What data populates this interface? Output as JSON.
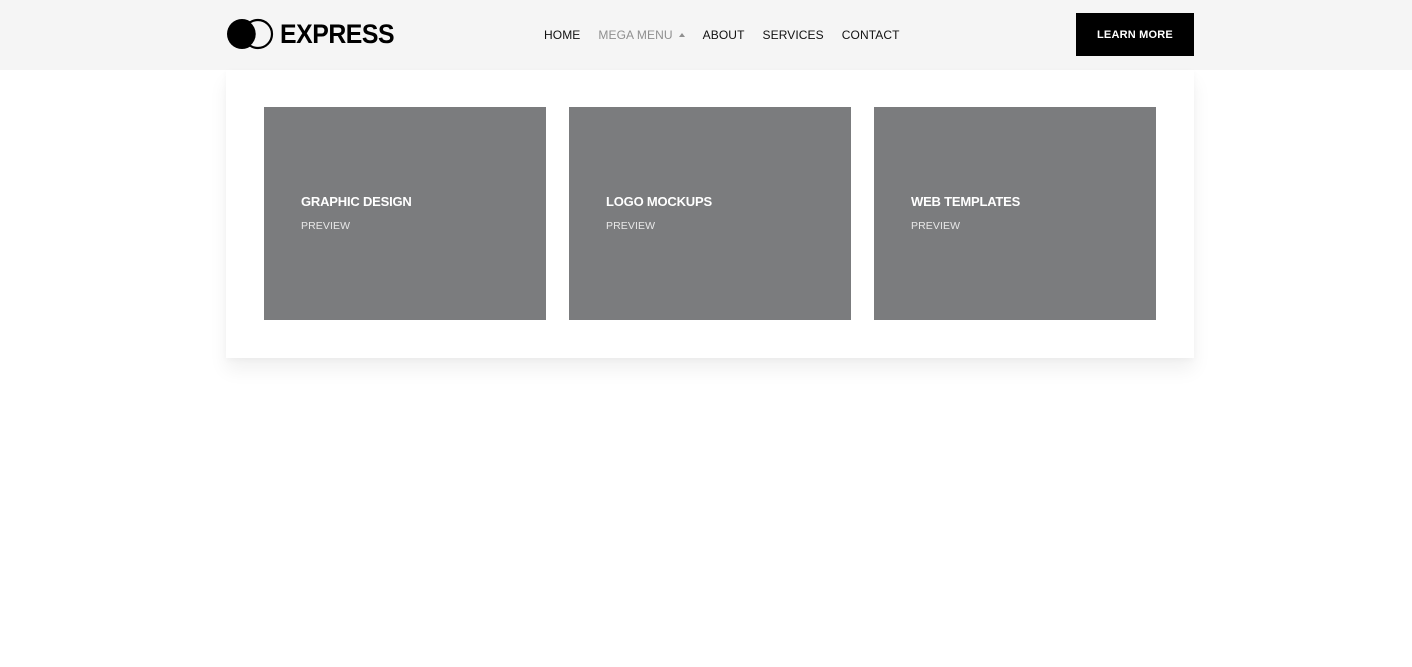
{
  "brand": {
    "name": "EXPRESS",
    "logo_icon": "overlapping-circles-icon"
  },
  "nav": {
    "items": [
      {
        "label": "HOME",
        "active": false
      },
      {
        "label": "MEGA MENU",
        "active": true,
        "icon": "caret-up-icon"
      },
      {
        "label": "ABOUT",
        "active": false
      },
      {
        "label": "SERVICES",
        "active": false
      },
      {
        "label": "CONTACT",
        "active": false
      }
    ]
  },
  "cta": {
    "label": "LEARN MORE"
  },
  "mega_menu": {
    "cards": [
      {
        "title": "GRAPHIC DESIGN",
        "subtitle": "PREVIEW"
      },
      {
        "title": "LOGO MOCKUPS",
        "subtitle": "PREVIEW"
      },
      {
        "title": "WEB TEMPLATES",
        "subtitle": "PREVIEW"
      }
    ]
  },
  "colors": {
    "header_bg": "#f5f5f5",
    "card_bg": "#7b7c7e",
    "cta_bg": "#000000",
    "active_nav": "#8f8f8f"
  }
}
